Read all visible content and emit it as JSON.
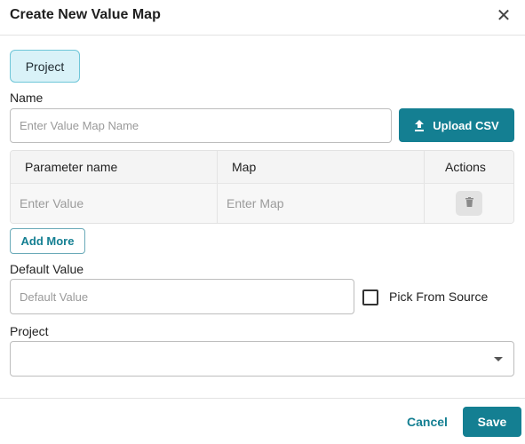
{
  "dialog": {
    "title": "Create New Value Map",
    "close_icon": "close-icon",
    "project_chip": "Project"
  },
  "name_field": {
    "label": "Name",
    "placeholder": "Enter Value Map Name",
    "value": ""
  },
  "upload": {
    "label": "Upload CSV",
    "icon": "upload-icon"
  },
  "table": {
    "columns": [
      "Parameter name",
      "Map",
      "Actions"
    ],
    "rows": [
      {
        "parameter_placeholder": "Enter Value",
        "map_placeholder": "Enter Map",
        "action_icon": "trash-icon"
      }
    ]
  },
  "add_more": {
    "label": "Add More"
  },
  "default_value": {
    "label": "Default Value",
    "placeholder": "Default Value",
    "value": ""
  },
  "pick_from_source": {
    "label": "Pick From Source",
    "checked": false
  },
  "project_select": {
    "label": "Project",
    "selected": ""
  },
  "footer": {
    "cancel_label": "Cancel",
    "save_label": "Save"
  },
  "colors": {
    "accent": "#147f92",
    "chip_bg": "#d9f2f8",
    "chip_border": "#6fc6d8"
  }
}
